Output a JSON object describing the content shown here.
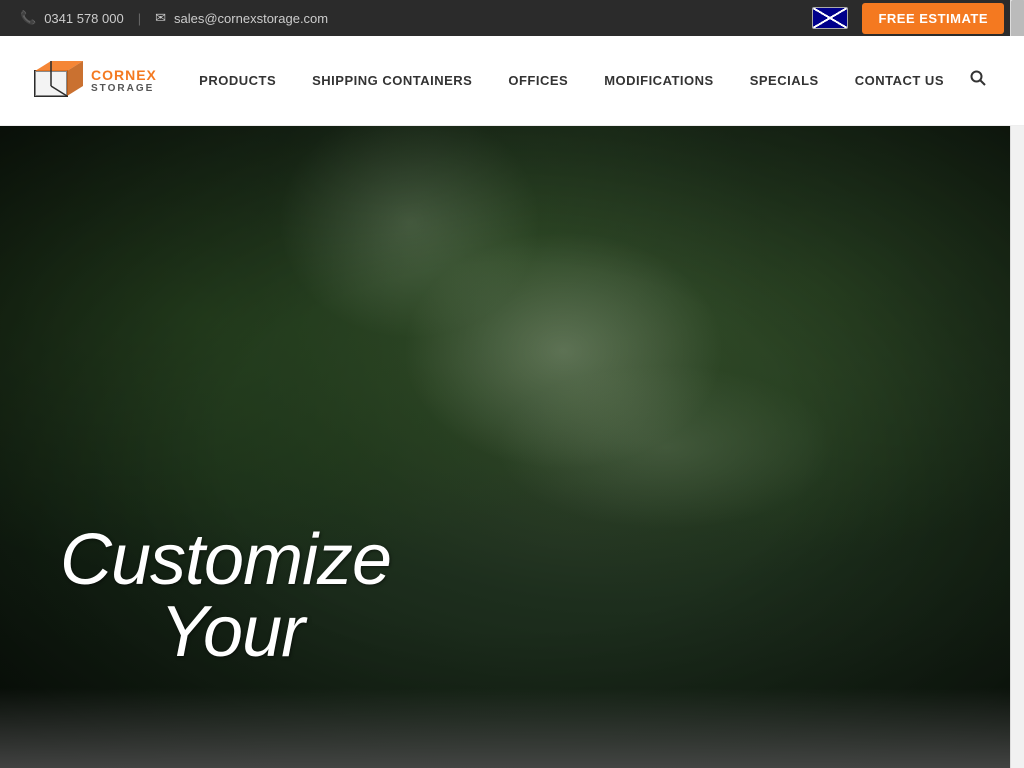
{
  "topbar": {
    "phone": "0341 578 000",
    "email": "sales@cornexstorage.com",
    "separator": "|",
    "free_estimate_label": "FREE ESTIMATE"
  },
  "nav": {
    "logo_name": "CORNEX STORAGE",
    "items": [
      {
        "label": "PRODUCTS",
        "id": "products"
      },
      {
        "label": "SHIPPING CONTAINERS",
        "id": "shipping-containers"
      },
      {
        "label": "OFFICES",
        "id": "offices"
      },
      {
        "label": "MODIFICATIONS",
        "id": "modifications"
      },
      {
        "label": "SPECIALS",
        "id": "specials"
      },
      {
        "label": "CONTACT US",
        "id": "contact-us"
      }
    ]
  },
  "hero": {
    "line1": "Customize",
    "line2": "Your"
  },
  "colors": {
    "accent": "#f47920",
    "dark": "#2b2b2b",
    "nav_text": "#333333"
  }
}
